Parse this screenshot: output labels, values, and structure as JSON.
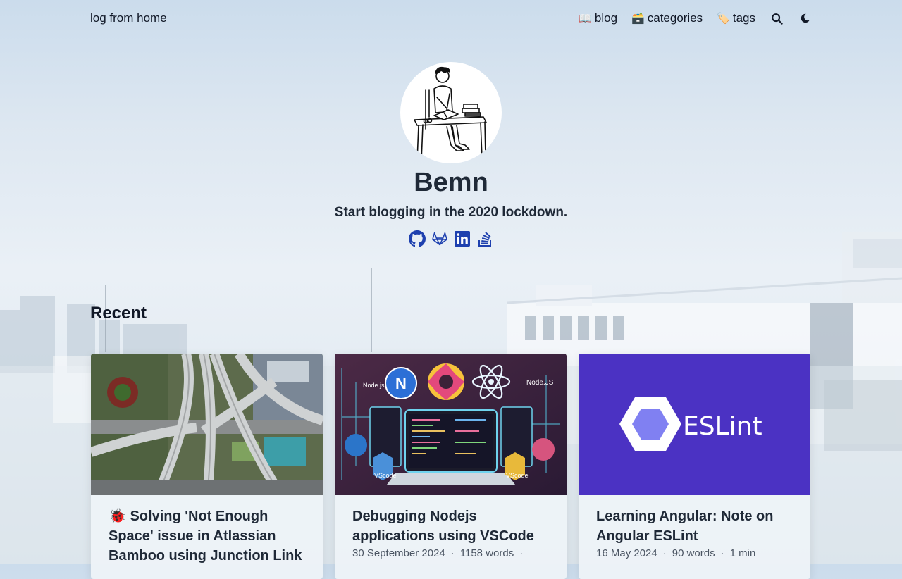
{
  "site": {
    "brand": "log from home"
  },
  "nav": {
    "items": [
      {
        "emoji": "📖",
        "label": "blog"
      },
      {
        "emoji": "🗃️",
        "label": "categories"
      },
      {
        "emoji": "🏷️",
        "label": "tags"
      }
    ],
    "icons": [
      "search-icon",
      "moon-icon"
    ]
  },
  "profile": {
    "name": "Bemn",
    "tagline": "Start blogging in the 2020 lockdown.",
    "socials": [
      "github-icon",
      "gitlab-icon",
      "linkedin-icon",
      "stackoverflow-icon"
    ]
  },
  "recent": {
    "heading": "Recent",
    "posts": [
      {
        "emoji": "🐞",
        "title": "Solving 'Not Enough Space' issue in Atlassian Bamboo using Junction Link",
        "thumbnail": "aerial-highway-photo"
      },
      {
        "title": "Debugging Nodejs applications using VSCode",
        "date": "30 September 2024",
        "words": "1158 words",
        "thumbnail": "nodejs-vscode-illustration",
        "thumb_labels": {
          "n_logo": "N",
          "node1": "Node.js",
          "node2": "Node.JS",
          "vscode": "VScode"
        }
      },
      {
        "title": "Learning Angular: Note on Angular ESLint",
        "date": "16 May 2024",
        "words": "90 words",
        "read": "1 min",
        "thumbnail": "eslint-logo",
        "logo_text": "ESLint"
      }
    ]
  },
  "colors": {
    "link_blue": "#1e40af",
    "eslint_purple": "#4b32c3",
    "text_dark": "#1f2937"
  }
}
